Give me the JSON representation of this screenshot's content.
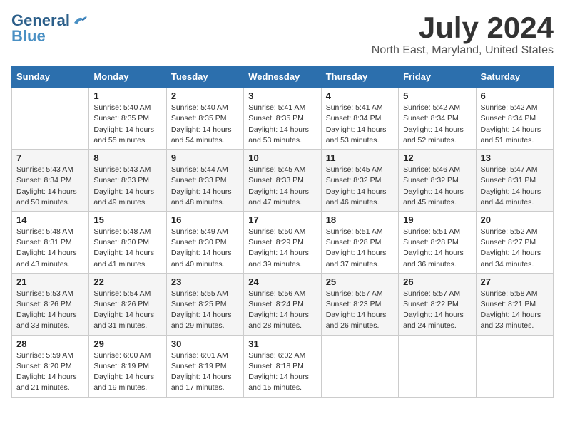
{
  "header": {
    "logo_line1": "General",
    "logo_line2": "Blue",
    "month_year": "July 2024",
    "location": "North East, Maryland, United States"
  },
  "days_of_week": [
    "Sunday",
    "Monday",
    "Tuesday",
    "Wednesday",
    "Thursday",
    "Friday",
    "Saturday"
  ],
  "weeks": [
    [
      {
        "day": "",
        "info": ""
      },
      {
        "day": "1",
        "info": "Sunrise: 5:40 AM\nSunset: 8:35 PM\nDaylight: 14 hours\nand 55 minutes."
      },
      {
        "day": "2",
        "info": "Sunrise: 5:40 AM\nSunset: 8:35 PM\nDaylight: 14 hours\nand 54 minutes."
      },
      {
        "day": "3",
        "info": "Sunrise: 5:41 AM\nSunset: 8:35 PM\nDaylight: 14 hours\nand 53 minutes."
      },
      {
        "day": "4",
        "info": "Sunrise: 5:41 AM\nSunset: 8:34 PM\nDaylight: 14 hours\nand 53 minutes."
      },
      {
        "day": "5",
        "info": "Sunrise: 5:42 AM\nSunset: 8:34 PM\nDaylight: 14 hours\nand 52 minutes."
      },
      {
        "day": "6",
        "info": "Sunrise: 5:42 AM\nSunset: 8:34 PM\nDaylight: 14 hours\nand 51 minutes."
      }
    ],
    [
      {
        "day": "7",
        "info": "Sunrise: 5:43 AM\nSunset: 8:34 PM\nDaylight: 14 hours\nand 50 minutes."
      },
      {
        "day": "8",
        "info": "Sunrise: 5:43 AM\nSunset: 8:33 PM\nDaylight: 14 hours\nand 49 minutes."
      },
      {
        "day": "9",
        "info": "Sunrise: 5:44 AM\nSunset: 8:33 PM\nDaylight: 14 hours\nand 48 minutes."
      },
      {
        "day": "10",
        "info": "Sunrise: 5:45 AM\nSunset: 8:33 PM\nDaylight: 14 hours\nand 47 minutes."
      },
      {
        "day": "11",
        "info": "Sunrise: 5:45 AM\nSunset: 8:32 PM\nDaylight: 14 hours\nand 46 minutes."
      },
      {
        "day": "12",
        "info": "Sunrise: 5:46 AM\nSunset: 8:32 PM\nDaylight: 14 hours\nand 45 minutes."
      },
      {
        "day": "13",
        "info": "Sunrise: 5:47 AM\nSunset: 8:31 PM\nDaylight: 14 hours\nand 44 minutes."
      }
    ],
    [
      {
        "day": "14",
        "info": "Sunrise: 5:48 AM\nSunset: 8:31 PM\nDaylight: 14 hours\nand 43 minutes."
      },
      {
        "day": "15",
        "info": "Sunrise: 5:48 AM\nSunset: 8:30 PM\nDaylight: 14 hours\nand 41 minutes."
      },
      {
        "day": "16",
        "info": "Sunrise: 5:49 AM\nSunset: 8:30 PM\nDaylight: 14 hours\nand 40 minutes."
      },
      {
        "day": "17",
        "info": "Sunrise: 5:50 AM\nSunset: 8:29 PM\nDaylight: 14 hours\nand 39 minutes."
      },
      {
        "day": "18",
        "info": "Sunrise: 5:51 AM\nSunset: 8:28 PM\nDaylight: 14 hours\nand 37 minutes."
      },
      {
        "day": "19",
        "info": "Sunrise: 5:51 AM\nSunset: 8:28 PM\nDaylight: 14 hours\nand 36 minutes."
      },
      {
        "day": "20",
        "info": "Sunrise: 5:52 AM\nSunset: 8:27 PM\nDaylight: 14 hours\nand 34 minutes."
      }
    ],
    [
      {
        "day": "21",
        "info": "Sunrise: 5:53 AM\nSunset: 8:26 PM\nDaylight: 14 hours\nand 33 minutes."
      },
      {
        "day": "22",
        "info": "Sunrise: 5:54 AM\nSunset: 8:26 PM\nDaylight: 14 hours\nand 31 minutes."
      },
      {
        "day": "23",
        "info": "Sunrise: 5:55 AM\nSunset: 8:25 PM\nDaylight: 14 hours\nand 29 minutes."
      },
      {
        "day": "24",
        "info": "Sunrise: 5:56 AM\nSunset: 8:24 PM\nDaylight: 14 hours\nand 28 minutes."
      },
      {
        "day": "25",
        "info": "Sunrise: 5:57 AM\nSunset: 8:23 PM\nDaylight: 14 hours\nand 26 minutes."
      },
      {
        "day": "26",
        "info": "Sunrise: 5:57 AM\nSunset: 8:22 PM\nDaylight: 14 hours\nand 24 minutes."
      },
      {
        "day": "27",
        "info": "Sunrise: 5:58 AM\nSunset: 8:21 PM\nDaylight: 14 hours\nand 23 minutes."
      }
    ],
    [
      {
        "day": "28",
        "info": "Sunrise: 5:59 AM\nSunset: 8:20 PM\nDaylight: 14 hours\nand 21 minutes."
      },
      {
        "day": "29",
        "info": "Sunrise: 6:00 AM\nSunset: 8:19 PM\nDaylight: 14 hours\nand 19 minutes."
      },
      {
        "day": "30",
        "info": "Sunrise: 6:01 AM\nSunset: 8:19 PM\nDaylight: 14 hours\nand 17 minutes."
      },
      {
        "day": "31",
        "info": "Sunrise: 6:02 AM\nSunset: 8:18 PM\nDaylight: 14 hours\nand 15 minutes."
      },
      {
        "day": "",
        "info": ""
      },
      {
        "day": "",
        "info": ""
      },
      {
        "day": "",
        "info": ""
      }
    ]
  ]
}
